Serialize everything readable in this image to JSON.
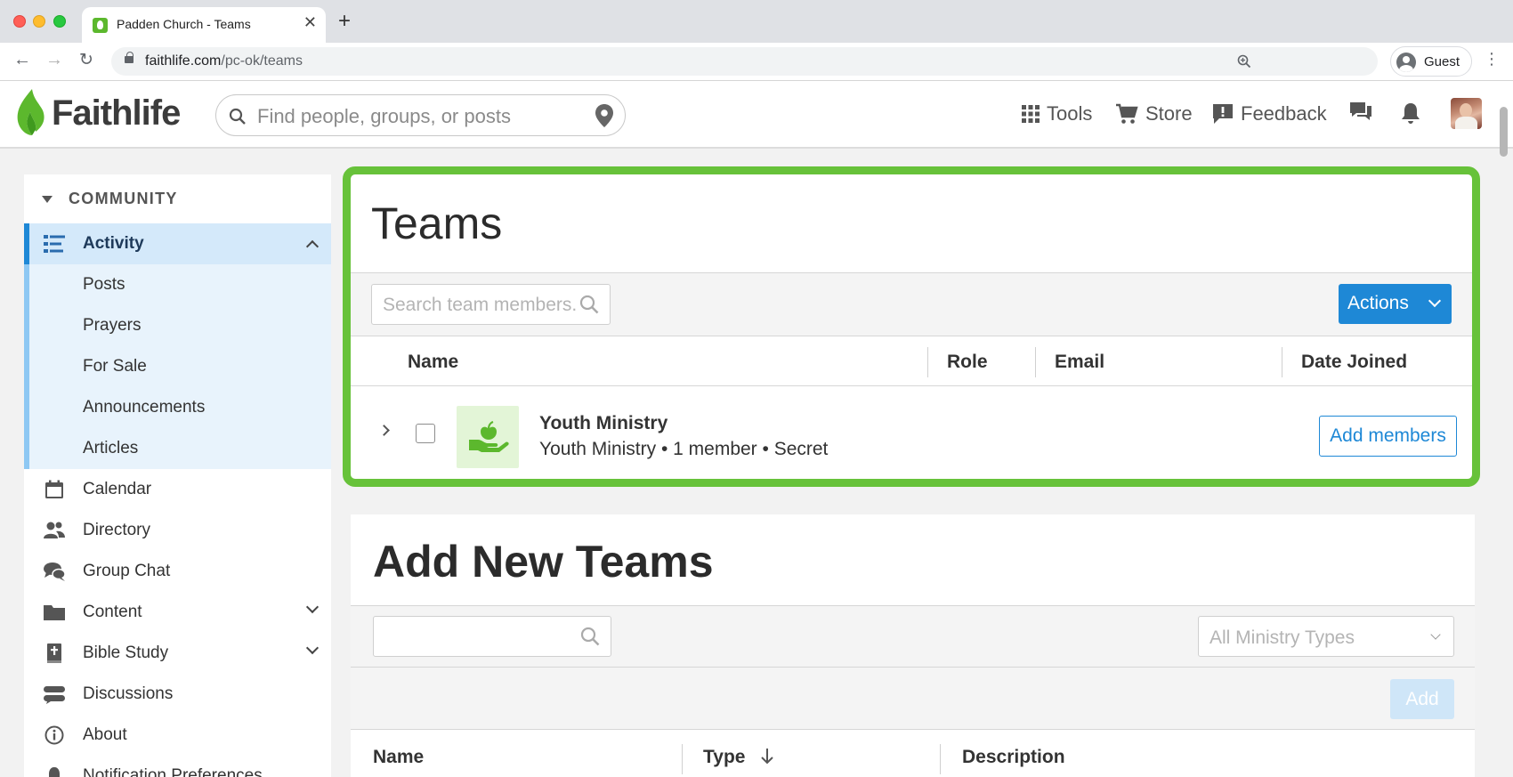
{
  "browser": {
    "tab_title": "Padden Church - Teams",
    "new_tab_symbol": "+",
    "url_host": "faithlife.com",
    "url_path": "/pc-ok/teams",
    "profile_label": "Guest"
  },
  "header": {
    "logo_text": "Faithlife",
    "search_placeholder": "Find people, groups, or posts",
    "nav": {
      "tools": "Tools",
      "store": "Store",
      "feedback": "Feedback"
    }
  },
  "sidebar": {
    "section_label": "COMMUNITY",
    "activity_label": "Activity",
    "activity_sub": [
      "Posts",
      "Prayers",
      "For Sale",
      "Announcements",
      "Articles"
    ],
    "items": [
      {
        "label": "Calendar",
        "icon": "calendar-icon"
      },
      {
        "label": "Directory",
        "icon": "people-icon"
      },
      {
        "label": "Group Chat",
        "icon": "chat-bubbles-icon"
      },
      {
        "label": "Content",
        "icon": "folder-icon"
      },
      {
        "label": "Bible Study",
        "icon": "bible-icon"
      },
      {
        "label": "Discussions",
        "icon": "discussions-icon"
      },
      {
        "label": "About",
        "icon": "info-icon"
      },
      {
        "label": "Notification Preferences",
        "icon": "bell-icon"
      }
    ]
  },
  "teams": {
    "title": "Teams",
    "search_placeholder": "Search team members...",
    "actions_label": "Actions",
    "columns": [
      "Name",
      "Role",
      "Email",
      "Date Joined"
    ],
    "rows": [
      {
        "name": "Youth Ministry",
        "meta": "Youth Ministry • 1 member • Secret",
        "action_label": "Add members",
        "checked": false
      }
    ]
  },
  "add_teams": {
    "title": "Add New Teams",
    "search_value": "",
    "ministry_filter": "All Ministry Types",
    "add_label": "Add",
    "columns": [
      "Name",
      "Type",
      "Description"
    ]
  },
  "colors": {
    "brand_green": "#67c23a",
    "primary_blue": "#1e88d6",
    "sidebar_active_bg": "#d4e9fa"
  }
}
